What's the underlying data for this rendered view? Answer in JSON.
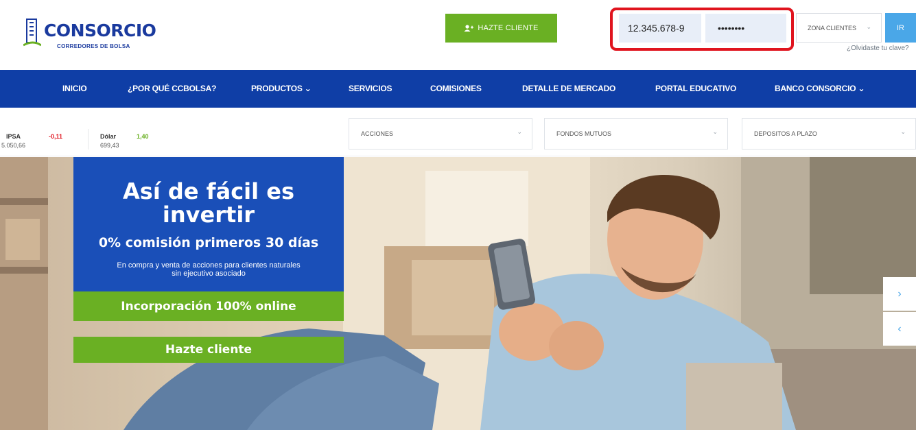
{
  "header": {
    "logo_text": "CONSORCIO",
    "logo_subtitle": "CORREDORES DE BOLSA",
    "hazte_cliente_label": "HAZTE CLIENTE",
    "rut_value": "12.345.678-9",
    "password_value": "••••••••",
    "zona_label": "ZONA CLIENTES",
    "ir_label": "IR",
    "forgot_label": "¿Olvidaste tu clave?"
  },
  "nav": {
    "items": [
      "INICIO",
      "¿POR QUÉ CCBOLSA?",
      "PRODUCTOS ⌄",
      "SERVICIOS",
      "COMISIONES",
      "DETALLE DE MERCADO",
      "PORTAL EDUCATIVO",
      "BANCO CONSORCIO ⌄"
    ]
  },
  "ticker": {
    "ipsa": {
      "name": "IPSA",
      "value": "5.050,66",
      "change": "-0,11"
    },
    "dolar": {
      "name": "Dólar",
      "value": "699,43",
      "change": "1,40"
    }
  },
  "dropdowns": [
    "ACCIONES",
    "FONDOS MUTUOS",
    "DEPOSITOS A PLAZO"
  ],
  "hero": {
    "title_line1": "Así de fácil es",
    "title_line2": "invertir",
    "subtitle": "0% comisión primeros 30 días",
    "small_line1": "En compra y venta de acciones para clientes naturales",
    "small_line2": "sin ejecutivo asociado",
    "green_bar": "Incorporación 100% online",
    "cta": "Hazte cliente"
  },
  "colors": {
    "brand_blue": "#0f3ea6",
    "brand_green": "#6ab023",
    "highlight_red": "#e0141e",
    "accent_light_blue": "#4aa7e8"
  },
  "icons": [
    "user-plus-icon",
    "chevron-down-icon",
    "chevron-right-icon",
    "chevron-left-icon"
  ]
}
